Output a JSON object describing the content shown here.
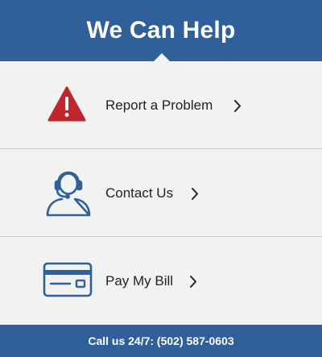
{
  "header": {
    "title": "We Can Help"
  },
  "menu": {
    "items": [
      {
        "label": "Report a Problem",
        "icon": "warning-icon",
        "icon_color": "#c0272d"
      },
      {
        "label": "Contact Us",
        "icon": "headset-agent-icon",
        "icon_color": "#2f609a"
      },
      {
        "label": "Pay My Bill",
        "icon": "credit-card-icon",
        "icon_color": "#2f609a"
      }
    ]
  },
  "footer": {
    "text": "Call us 24/7: (502) 587-0603"
  },
  "colors": {
    "brand_blue": "#2f609a",
    "alert_red": "#c0272d",
    "background": "#f2f2f2",
    "divider": "#c9c9c9"
  }
}
